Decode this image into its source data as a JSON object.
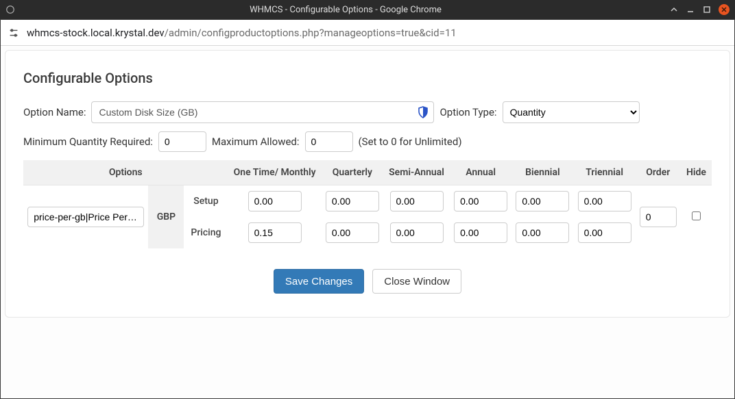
{
  "window": {
    "title": "WHMCS - Configurable Options - Google Chrome"
  },
  "address": {
    "domain": "whmcs-stock.local.krystal.dev",
    "path": "/admin/configproductoptions.php?manageoptions=true&cid=11"
  },
  "page": {
    "heading": "Configurable Options",
    "option_name_label": "Option Name:",
    "option_name_value": "Custom Disk Size (GB)",
    "option_type_label": "Option Type:",
    "option_type_value": "Quantity",
    "min_qty_label": "Minimum Quantity Required:",
    "min_qty_value": "0",
    "max_allowed_label": "Maximum Allowed:",
    "max_allowed_value": "0",
    "unlimited_hint": "(Set to 0 for Unlimited)"
  },
  "pricing_table": {
    "headers": {
      "options": "Options",
      "onetime": "One Time/ Monthly",
      "quarterly": "Quarterly",
      "semi": "Semi-Annual",
      "annual": "Annual",
      "biennial": "Biennial",
      "triennial": "Triennial",
      "order": "Order",
      "hide": "Hide"
    },
    "currency": "GBP",
    "option_row_value": "price-per-gb|Price Per GB",
    "row_labels": {
      "setup": "Setup",
      "pricing": "Pricing"
    },
    "setup": {
      "onetime": "0.00",
      "quarterly": "0.00",
      "semi": "0.00",
      "annual": "0.00",
      "biennial": "0.00",
      "triennial": "0.00"
    },
    "pricing": {
      "onetime": "0.15",
      "quarterly": "0.00",
      "semi": "0.00",
      "annual": "0.00",
      "biennial": "0.00",
      "triennial": "0.00"
    },
    "order_value": "0",
    "hide_checked": false
  },
  "buttons": {
    "save": "Save Changes",
    "close": "Close Window"
  }
}
